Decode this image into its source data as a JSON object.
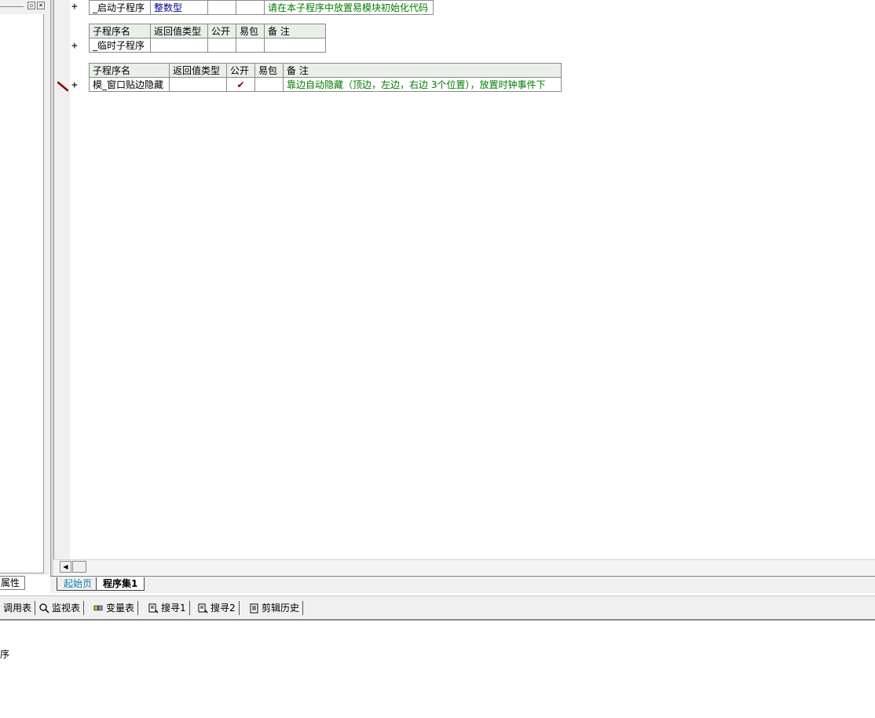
{
  "left_panel": {
    "tab_label": "属性",
    "buttons": [
      "▫",
      "×"
    ]
  },
  "editor": {
    "tables": [
      {
        "rows": [
          {
            "name": "_启动子程序",
            "return_type": "整数型",
            "public": "",
            "easy_pack": "",
            "note": "请在本子程序中放置易模块初始化代码"
          }
        ]
      },
      {
        "headers": [
          "子程序名",
          "返回值类型",
          "公开",
          "易包",
          "备 注"
        ],
        "rows": [
          {
            "name": "_临时子程序",
            "return_type": "",
            "public": "",
            "easy_pack": "",
            "note": ""
          }
        ]
      },
      {
        "headers": [
          "子程序名",
          "返回值类型",
          "公开",
          "易包",
          "备 注"
        ],
        "rows": [
          {
            "name": "模_窗口贴边隐藏",
            "return_type": "",
            "public": "✔",
            "easy_pack": "",
            "note": "靠边自动隐藏（顶边，左边，右边  3个位置），放置时钟事件下"
          }
        ]
      }
    ],
    "gutter_plus": "+"
  },
  "doc_tabs": [
    {
      "label": "起始页",
      "active": false
    },
    {
      "label": "程序集1",
      "active": true
    }
  ],
  "bottom_toolbar": [
    {
      "label": "调用表",
      "icon": "call-table-icon"
    },
    {
      "label": "监视表",
      "icon": "magnifier-icon"
    },
    {
      "label": "变量表",
      "icon": "variables-icon"
    },
    {
      "label": "搜寻1",
      "icon": "search-doc-icon"
    },
    {
      "label": "搜寻2",
      "icon": "search-doc-icon"
    },
    {
      "label": "剪辑历史",
      "icon": "clipboard-history-icon"
    }
  ],
  "output": {
    "text": "序"
  },
  "colors": {
    "note_green": "#007a00",
    "type_blue": "#000090",
    "header_bg": "#e8f0e8",
    "check_red": "#8b0000",
    "tab_blue": "#0a7fb0"
  }
}
